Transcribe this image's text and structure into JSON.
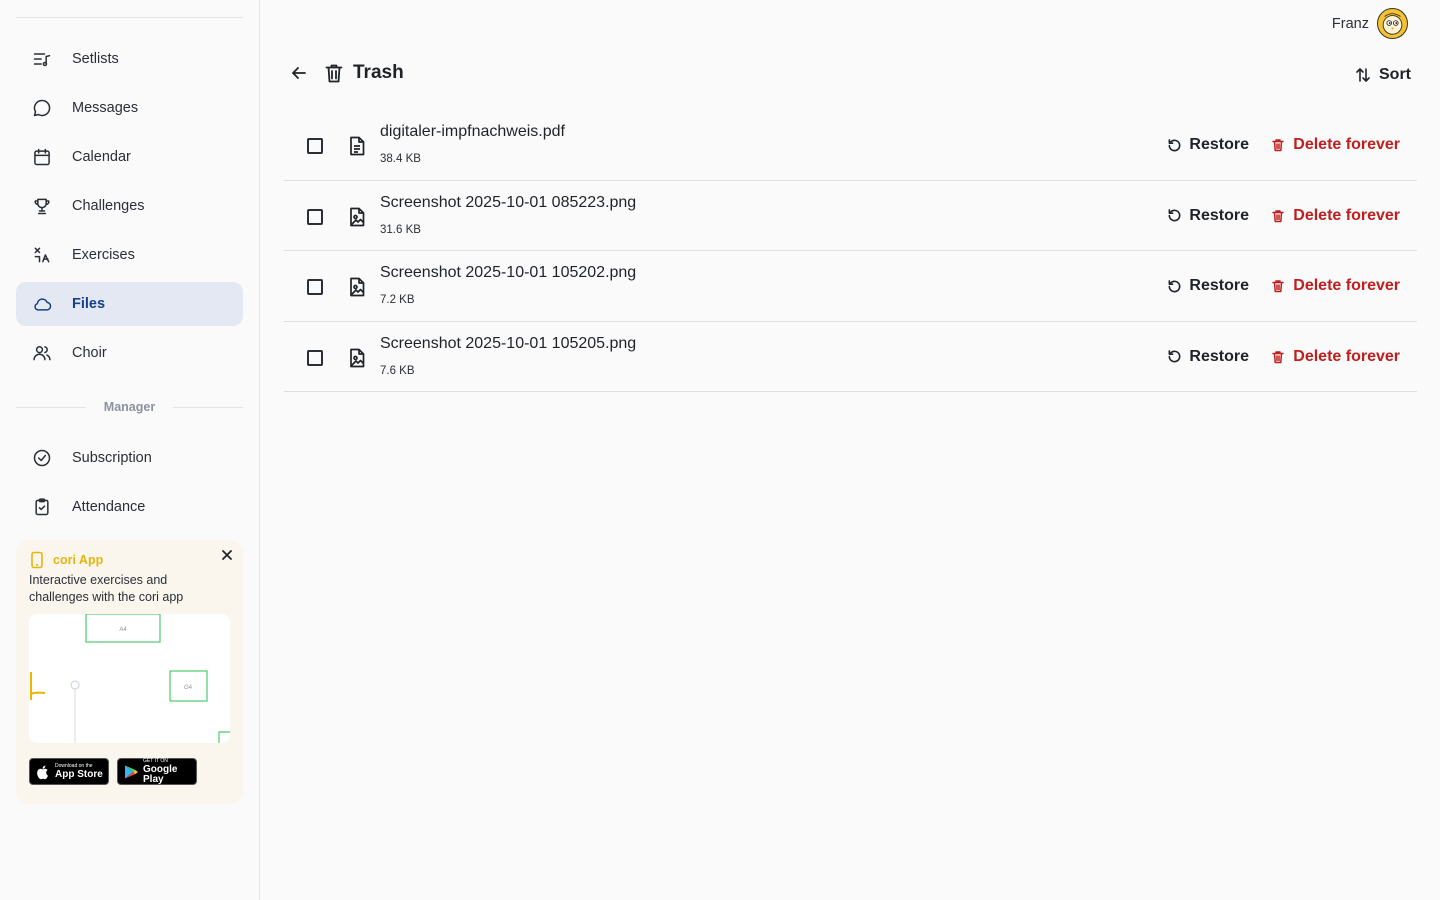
{
  "sidebar": {
    "items": [
      {
        "label": "Setlists",
        "icon": "setlist-icon"
      },
      {
        "label": "Messages",
        "icon": "message-icon"
      },
      {
        "label": "Calendar",
        "icon": "calendar-icon"
      },
      {
        "label": "Challenges",
        "icon": "trophy-icon"
      },
      {
        "label": "Exercises",
        "icon": "exercises-icon"
      },
      {
        "label": "Files",
        "icon": "cloud-icon",
        "active": true
      },
      {
        "label": "Choir",
        "icon": "users-icon"
      }
    ],
    "section_label": "Manager",
    "manager_items": [
      {
        "label": "Subscription",
        "icon": "check-circle-icon"
      },
      {
        "label": "Attendance",
        "icon": "clipboard-check-icon"
      }
    ],
    "promo": {
      "title": "cori App",
      "description": "Interactive exercises and challenges with the cori app",
      "preview_labels": [
        "A4",
        "G4"
      ],
      "app_store_small": "Download on the",
      "app_store_big": "App Store",
      "google_small": "GET IT ON",
      "google_big": "Google Play"
    }
  },
  "user": {
    "name": "Franz"
  },
  "header": {
    "title": "Trash",
    "sort_label": "Sort"
  },
  "files": [
    {
      "name": "digitaler-impfnachweis.pdf",
      "size": "38.4 KB",
      "type": "document"
    },
    {
      "name": "Screenshot 2025-10-01 085223.png",
      "size": "31.6 KB",
      "type": "image"
    },
    {
      "name": "Screenshot 2025-10-01 105202.png",
      "size": "7.2 KB",
      "type": "image"
    },
    {
      "name": "Screenshot 2025-10-01 105205.png",
      "size": "7.6 KB",
      "type": "image"
    }
  ],
  "actions": {
    "restore": "Restore",
    "delete": "Delete forever"
  },
  "colors": {
    "accent": "#17408b",
    "active_bg": "#e3e8f2",
    "danger": "#c01f1f",
    "promo_yellow": "#e8b40c"
  }
}
